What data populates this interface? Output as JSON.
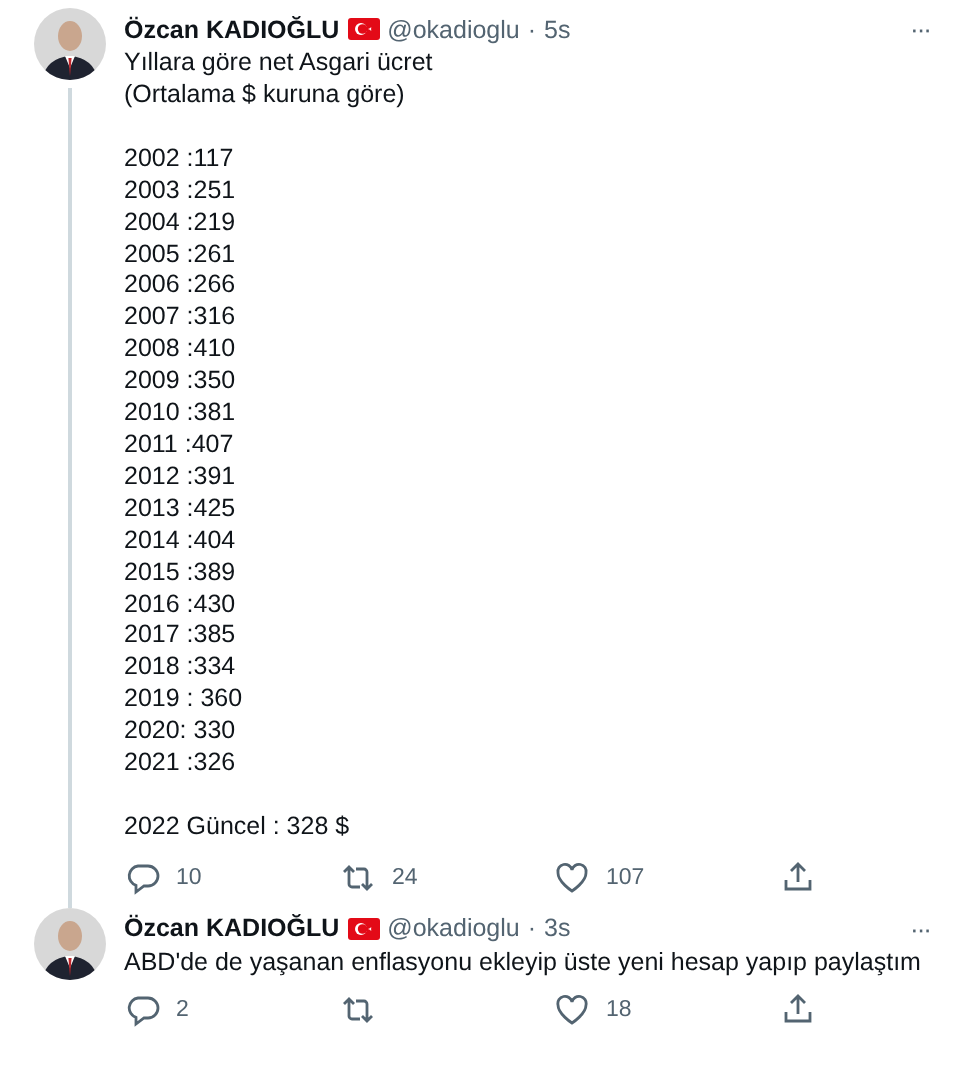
{
  "tweets": [
    {
      "author": "Özcan KADIOĞLU",
      "handle": "@okadioglu",
      "separator": "·",
      "time": "5s",
      "more": "···",
      "thread_line": true,
      "paragraphs": [
        "Yıllara göre net Asgari ücret\n(Ortalama $ kuruna göre)",
        "2002 :117\n2003 :251\n2004 :219\n2005 :261\n2006 :266\n2007 :316\n2008 :410\n2009 :350\n2010 :381\n2011 :407\n2012 :391\n2013 :425\n2014 :404\n2015 :389\n2016 :430\n2017 :385\n2018 :334\n2019 : 360\n2020: 330\n2021 :326",
        "2022 Güncel : 328 $"
      ],
      "actions": [
        {
          "kind": "reply",
          "count": "10"
        },
        {
          "kind": "retweet",
          "count": "24"
        },
        {
          "kind": "like",
          "count": "107"
        },
        {
          "kind": "share"
        }
      ]
    },
    {
      "author": "Özcan KADIOĞLU",
      "handle": "@okadioglu",
      "separator": "·",
      "time": "3s",
      "more": "···",
      "thread_line": false,
      "paragraphs": [
        "ABD'de de yaşanan enflasyonu ekleyip üste yeni hesap yapıp paylaştım"
      ],
      "actions": [
        {
          "kind": "reply",
          "count": "2"
        },
        {
          "kind": "retweet"
        },
        {
          "kind": "like",
          "count": "18"
        },
        {
          "kind": "share"
        }
      ]
    }
  ]
}
